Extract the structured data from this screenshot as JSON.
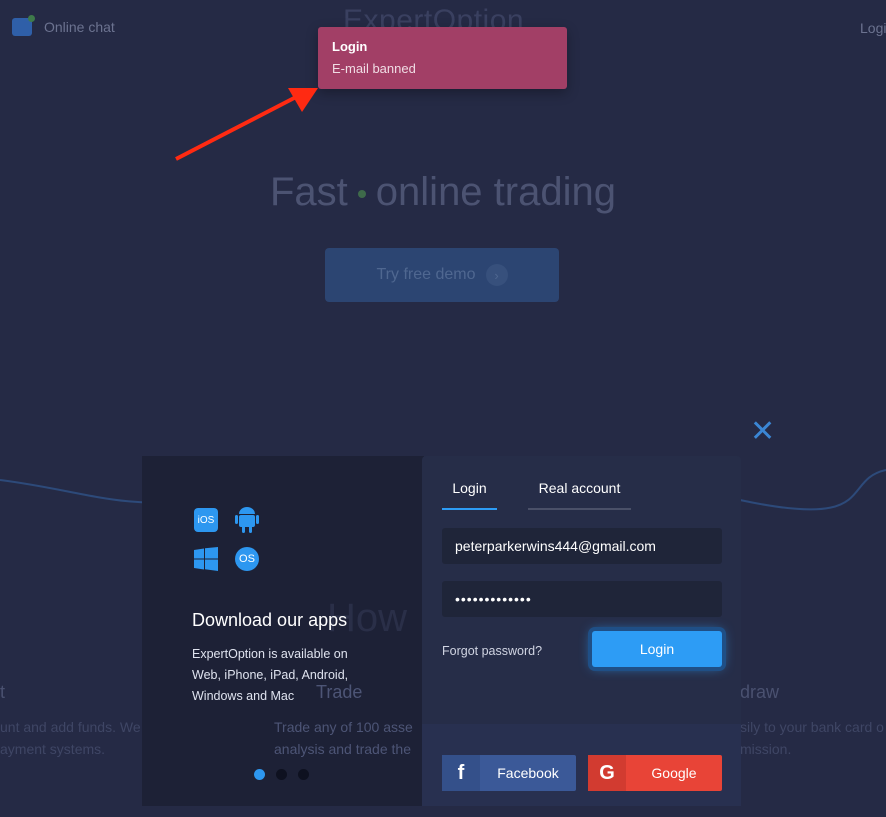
{
  "header": {
    "chat_label": "Online chat",
    "logo": "ExpertOption",
    "login_label": "Login"
  },
  "toast": {
    "title": "Login",
    "message": "E-mail banned",
    "color": "#a23f66"
  },
  "hero": {
    "title_left": "Fast",
    "title_right": "online trading",
    "demo_button": "Try free demo"
  },
  "background": {
    "how": "How",
    "col1_title": "t",
    "col1_text1": "unt and add funds. We work with",
    "col1_text2": "ayment systems.",
    "col2_title": "Trade",
    "col2_text1": "Trade any of 100 asse",
    "col2_text2": "analysis and trade the",
    "col3_title": "draw",
    "col3_text1": "sily to your bank card o",
    "col3_text2": "mission."
  },
  "apps": {
    "icons": [
      "ios-icon",
      "android-icon",
      "windows-icon",
      "macos-icon"
    ],
    "ios": "iOS",
    "macos": "OS",
    "title": "Download our apps",
    "line1": "ExpertOption is available on",
    "line2": "Web, iPhone, iPad, Android,",
    "line3": "Windows and Mac",
    "slide_active": 1,
    "slide_count": 3
  },
  "form": {
    "tabs": [
      {
        "label": "Login",
        "active": true
      },
      {
        "label": "Real account",
        "active": false
      }
    ],
    "email": "peterparkerwins444@gmail.com",
    "password": "•••••••••••••",
    "forgot": "Forgot password?",
    "login_button": "Login",
    "facebook": "Facebook",
    "google": "Google",
    "accent": "#2d9cf5"
  }
}
